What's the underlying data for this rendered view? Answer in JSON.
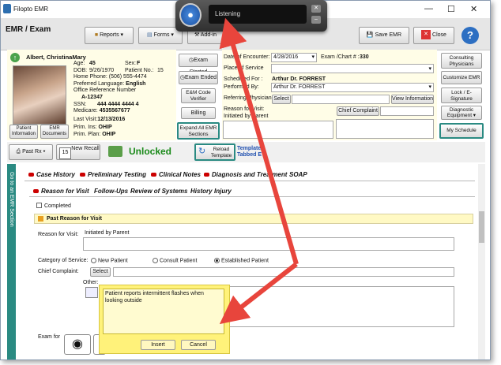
{
  "window": {
    "title": "Filopto EMR",
    "section_title": "EMR / Exam"
  },
  "toolbar": {
    "reports": "Reports",
    "forms": "Forms",
    "addin": "Add-in",
    "save": "Save EMR",
    "close": "Close",
    "help": "?"
  },
  "speech": {
    "status": "Listening"
  },
  "patient": {
    "name": "Albert, ChristinaMary",
    "age_label": "Age:",
    "age": "45",
    "sex_label": "Sex:",
    "sex": "F",
    "dob_label": "DOB:",
    "dob": "9/26/1970",
    "patient_no_label": "Patient No.:",
    "patient_no": "15",
    "home_phone_label": "Home Phone:",
    "home_phone": "(506) 555-4474",
    "pref_lang_label": "Preferred Language:",
    "pref_lang": "English",
    "office_ref_label": "Office Reference Number",
    "office_ref": "A-12347",
    "ssn_label": "SSN:",
    "ssn": "444 4444 4444 4",
    "medicare_label": "Medicare:",
    "medicare": "4535567677",
    "last_visit_label": "Last Visit:",
    "last_visit": "12/13/2016",
    "prim_ins_label": "Prim. Ins:",
    "prim_ins": "OHIP",
    "prim_plan_label": "Prim. Plan:",
    "prim_plan": "OHIP",
    "info_button": "Patient Information",
    "docs_button": "EMR Documents"
  },
  "exam_buttons": {
    "started": "Exam Started",
    "ended": "Exam Ended",
    "verifier": "E&M Code Verifier",
    "billing": "Billing",
    "expand": "Expand All EMR Sections"
  },
  "encounter": {
    "date_label": "Date of Encounter:",
    "date": "4/28/2016",
    "chart_label": "Exam /Chart # :",
    "chart": "330",
    "place_label": "Place of Service",
    "sched_label": "Scheduled For :",
    "sched": "Arthur Dr. FORREST",
    "perf_label": "Performed By:",
    "perf": "Arthur Dr. FORREST",
    "ref_label": "Referring Physician",
    "select": "Select",
    "view_info": "View Information",
    "reason_label": "Reason for Visit:",
    "reason": "Initiated by Parent",
    "chief_label": "Chief Complaint"
  },
  "right_buttons": {
    "consult": "Consulting Physicians",
    "customize": "Customize EMR",
    "lock": "Lock / E-Signature",
    "diag": "Diagnostic Equipment",
    "schedule": "My Schedule"
  },
  "second_toolbar": {
    "past_rx": "Past Rx",
    "new_recall": "New Recall",
    "recall_num": "15",
    "unlocked": "Unlocked",
    "reload": "Reload Template",
    "template_line1": "Template",
    "template_line2": "Tabbed E"
  },
  "sidebar": {
    "label": "Go to an EMR Section"
  },
  "main_tabs": [
    "Case History",
    "Preliminary Testing",
    "Clinical Notes",
    "Diagnosis and Treatment",
    "SOAP"
  ],
  "sub_tabs": [
    "Reason for Visit",
    "Follow-Ups",
    "Review of Systems",
    "History",
    "Injury"
  ],
  "form": {
    "completed": "Completed",
    "past_reason": "Past Reason for Visit",
    "reason_label": "Reason for Visit:",
    "reason_value": "Initiated by Parent",
    "category_label": "Category of Service:",
    "new_patient": "New Patient",
    "consult_patient": "Consult Patient",
    "established_patient": "Established Patient",
    "chief_label": "Chief Complaint:",
    "select": "Select",
    "other_label": "Other:",
    "exam_for": "Exam for"
  },
  "dictation": {
    "text": "Patient reports intermittent flashes when looking outside",
    "insert": "Insert",
    "cancel": "Cancel"
  },
  "colors": {
    "teal": "#2a8a82",
    "arrow": "#e8453c",
    "yellow": "#fff27a",
    "green": "#1a8a1a"
  }
}
